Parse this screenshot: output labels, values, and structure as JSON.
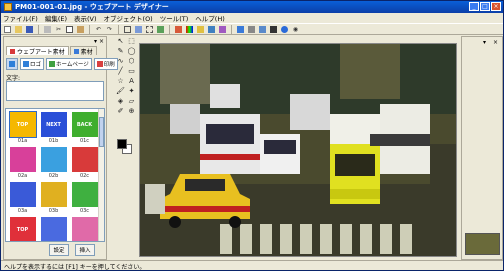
{
  "window": {
    "title": "PM01-001-01.jpg - ウェブアート デザイナー"
  },
  "menu": [
    "ファイル(F)",
    "編集(E)",
    "表示(V)",
    "オブジェクト(O)",
    "ツール(T)",
    "ヘルプ(H)"
  ],
  "left_panel": {
    "tabs": [
      "ウェブアート素材",
      "素材"
    ],
    "categories": [
      "",
      "ロゴ",
      "ホームページ",
      "印刷"
    ],
    "text_label": "文字:",
    "items": [
      {
        "text": "TOP",
        "label": "01a",
        "color": "#f5b800"
      },
      {
        "text": "NEXT",
        "label": "01b",
        "color": "#2a4fd8"
      },
      {
        "text": "BACK",
        "label": "01c",
        "color": "#3fae2e"
      },
      {
        "text": "",
        "label": "02a",
        "color": "#d8409a"
      },
      {
        "text": "",
        "label": "02b",
        "color": "#3aa0e0"
      },
      {
        "text": "",
        "label": "02c",
        "color": "#d83a3a"
      },
      {
        "text": "",
        "label": "03a",
        "color": "#3a5ad8"
      },
      {
        "text": "",
        "label": "03b",
        "color": "#e0b020"
      },
      {
        "text": "",
        "label": "03c",
        "color": "#3fb040"
      },
      {
        "text": "TOP",
        "label": "",
        "color": "#e0303a"
      },
      {
        "text": "",
        "label": "",
        "color": "#4a6ae0"
      },
      {
        "text": "",
        "label": "",
        "color": "#e06aa8"
      }
    ],
    "buttons": [
      "設定",
      "挿入"
    ]
  },
  "status": {
    "text": "ヘルプを表示するには [F1] キーを押してください。"
  }
}
